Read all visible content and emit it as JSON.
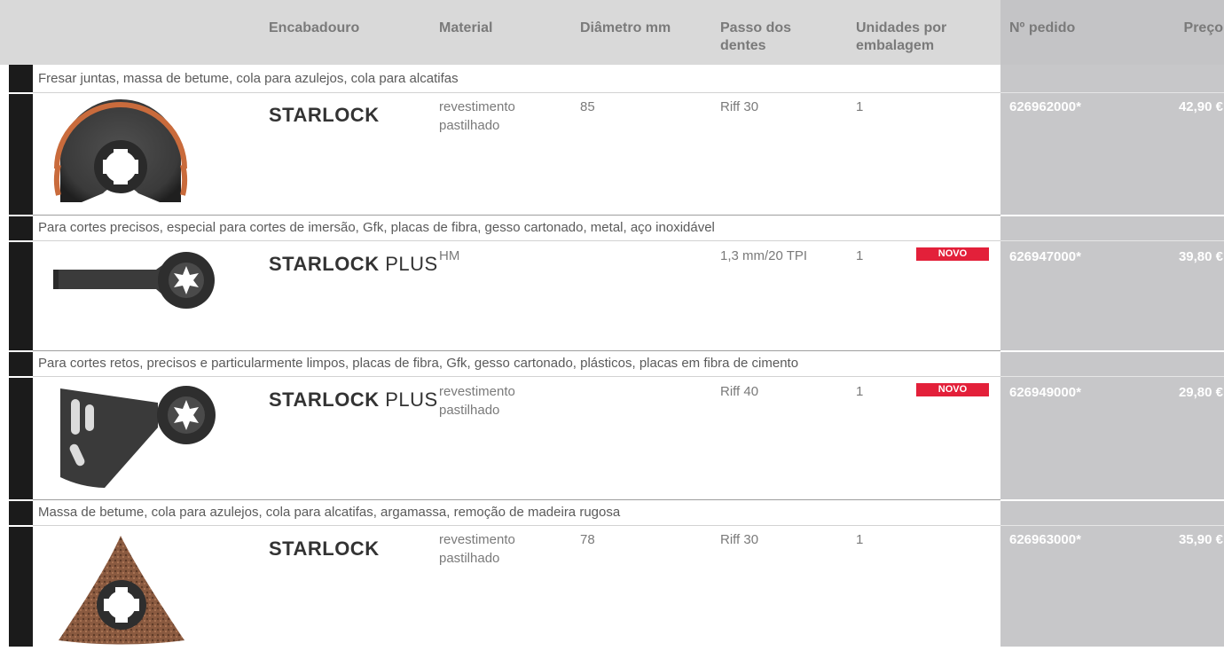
{
  "header": {
    "encabadouro": "Encabadouro",
    "material": "Material",
    "diametro": "Diâmetro mm",
    "passo_line1": "Passo dos",
    "passo_line2": "dentes",
    "unidades_line1": "Unidades por",
    "unidades_line2": "embalagem",
    "pedido": "Nº pedido",
    "preco": "Preço"
  },
  "rows": [
    {
      "category": "Fresar juntas, massa de betume, cola para azulejos, cola para alcatifas",
      "logo_text": "STARLOCK",
      "logo_plus": "",
      "material_line1": "revestimento",
      "material_line2": "pastilhado",
      "diametro": "85",
      "passo": "Riff 30",
      "unidades": "1",
      "badge": "",
      "pedido": "626962000*",
      "preco": "42,90 €",
      "image_icon": "segment-saw-blade-icon"
    },
    {
      "category": "Para cortes precisos, especial para cortes de imersão, Gfk, placas de fibra, gesso cartonado, metal, aço inoxidável",
      "logo_text": "STARLOCK",
      "logo_plus": "PLUS",
      "material_line1": "HM",
      "material_line2": "",
      "diametro": "",
      "passo": "1,3 mm/20 TPI",
      "unidades": "1",
      "badge": "NOVO",
      "pedido": "626947000*",
      "preco": "39,80 €",
      "image_icon": "plunge-cut-blade-icon"
    },
    {
      "category": "Para cortes retos, precisos e particularmente limpos, placas de fibra, Gfk, gesso cartonado, plásticos, placas em fibra de cimento",
      "logo_text": "STARLOCK",
      "logo_plus": "PLUS",
      "material_line1": "revestimento",
      "material_line2": "pastilhado",
      "diametro": "",
      "passo": "Riff 40",
      "unidades": "1",
      "badge": "NOVO",
      "pedido": "626949000*",
      "preco": "29,80 €",
      "image_icon": "rasp-blade-icon"
    },
    {
      "category": "Massa de betume, cola para azulejos, cola para alcatifas, argamassa, remoção de madeira rugosa",
      "logo_text": "STARLOCK",
      "logo_plus": "",
      "material_line1": "revestimento",
      "material_line2": "pastilhado",
      "diametro": "78",
      "passo": "Riff 30",
      "unidades": "1",
      "badge": "",
      "pedido": "626963000*",
      "preco": "35,90 €",
      "image_icon": "delta-rasp-plate-icon"
    }
  ]
}
